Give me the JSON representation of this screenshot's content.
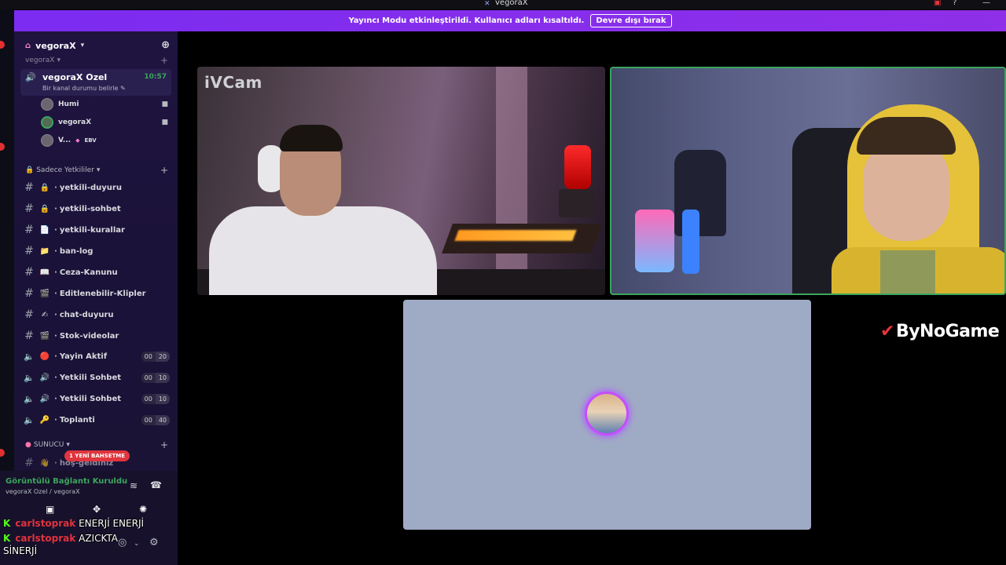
{
  "window": {
    "title": "vegoraX"
  },
  "banner": {
    "text": "Yayıncı Modu etkinleştirildi. Kullanıcı adları kısaltıldı.",
    "button_label": "Devre dışı bırak"
  },
  "server": {
    "name": "vegoraX"
  },
  "category_top": {
    "label": "vegoraX"
  },
  "voice_channel": {
    "name": "vegoraX Ozel",
    "time": "10:57",
    "status_prompt": "Bir kanal durumu belirle",
    "users": [
      {
        "name": "Humi"
      },
      {
        "name": "vegoraX"
      },
      {
        "name": "V...",
        "badge": "EBV"
      }
    ]
  },
  "category_admin": {
    "label": "Sadece Yetkililer"
  },
  "channels": [
    {
      "emoji": "🔒",
      "name": "yetkili-duyuru"
    },
    {
      "emoji": "🔒",
      "name": "yetkili-sohbet"
    },
    {
      "emoji": "📄",
      "name": "yetkili-kurallar"
    },
    {
      "emoji": "📁",
      "name": "ban-log"
    },
    {
      "emoji": "📖",
      "name": "Ceza-Kanunu"
    },
    {
      "emoji": "🎬",
      "name": "Editlenebilir-Klipler"
    },
    {
      "emoji": "✍",
      "name": "chat-duyuru"
    },
    {
      "emoji": "🎬",
      "name": "Stok-videolar"
    }
  ],
  "voice_channels": [
    {
      "emoji": "🔴",
      "name": "Yayin Aktif",
      "count_a": "00",
      "count_b": "20"
    },
    {
      "emoji": "🔊",
      "name": "Yetkili Sohbet",
      "count_a": "00",
      "count_b": "10"
    },
    {
      "emoji": "🔊",
      "name": "Yetkili Sohbet",
      "count_a": "00",
      "count_b": "10"
    },
    {
      "emoji": "🔑",
      "name": "Toplanti",
      "count_a": "00",
      "count_b": "40"
    }
  ],
  "category_server": {
    "label": "SUNUCU"
  },
  "partial_channel": {
    "emoji": "👋",
    "name": "hoş-geldiniz"
  },
  "mention_pill": "1 YENİ BAHSETME",
  "voice_panel": {
    "title": "Görüntülü Bağlantı Kuruldu",
    "subtitle": "vegoraX Ozel / vegoraX"
  },
  "overlay_chat": [
    {
      "user": "carlstoprak",
      "message": "ENERJİ ENERJİ"
    },
    {
      "user": "carlstoprak",
      "message": "AZICKTA SİNERJİ"
    }
  ],
  "video_tiles": {
    "tile1_label": "iVCam"
  },
  "watermark": "ByNoGame",
  "colors": {
    "accent": "#8a2be2",
    "voice_green": "#3ba55d",
    "speaking_ring": "#c54dff",
    "mention_red": "#e0353d"
  }
}
